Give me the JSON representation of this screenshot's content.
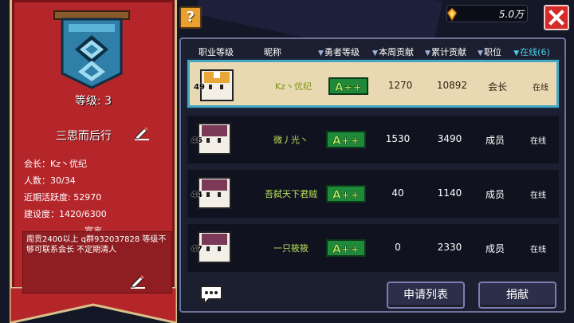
{
  "guild": {
    "level_text": "等级: 3",
    "name": "三思而后行",
    "leader": "会长：Kz丶优纪",
    "members": "人数：30/34",
    "activity": "近期活跃度: 52970",
    "construction": "建设度：1420/6300",
    "declaration_title": "宣言",
    "declaration": "周贡2400以上 q群932037828 等级不够可联系会长 不定期清人"
  },
  "topbar": {
    "help_label": "?",
    "currency_value": "5.0万"
  },
  "table": {
    "headers": {
      "rank": "职业等级",
      "nickname": "昵称",
      "hero_level": "勇者等级",
      "week": "本周贡献",
      "total": "累计贡献",
      "position": "职位",
      "online": "在线(6)"
    },
    "rows": [
      {
        "level": "49",
        "nickname": "Kz丶优纪",
        "grade": "A++",
        "week": "1270",
        "total": "10892",
        "position": "会长",
        "status": "在线"
      },
      {
        "level": "46",
        "nickname": "微丿光丶",
        "grade": "A++",
        "week": "1530",
        "total": "3490",
        "position": "成员",
        "status": "在线"
      },
      {
        "level": "44",
        "nickname": "吾弑天下君贼",
        "grade": "A++",
        "week": "40",
        "total": "1140",
        "position": "成员",
        "status": "在线"
      },
      {
        "level": "47",
        "nickname": "一只筱筱",
        "grade": "A++",
        "week": "0",
        "total": "2330",
        "position": "成员",
        "status": "在线"
      }
    ]
  },
  "buttons": {
    "apply_list": "申请列表",
    "donate": "捐献"
  },
  "colors": {
    "banner_red": "#b5262b",
    "selected_row": "#e8d9b2",
    "online_header": "#4ecbe8",
    "nickname_green": "#b8e05a"
  }
}
